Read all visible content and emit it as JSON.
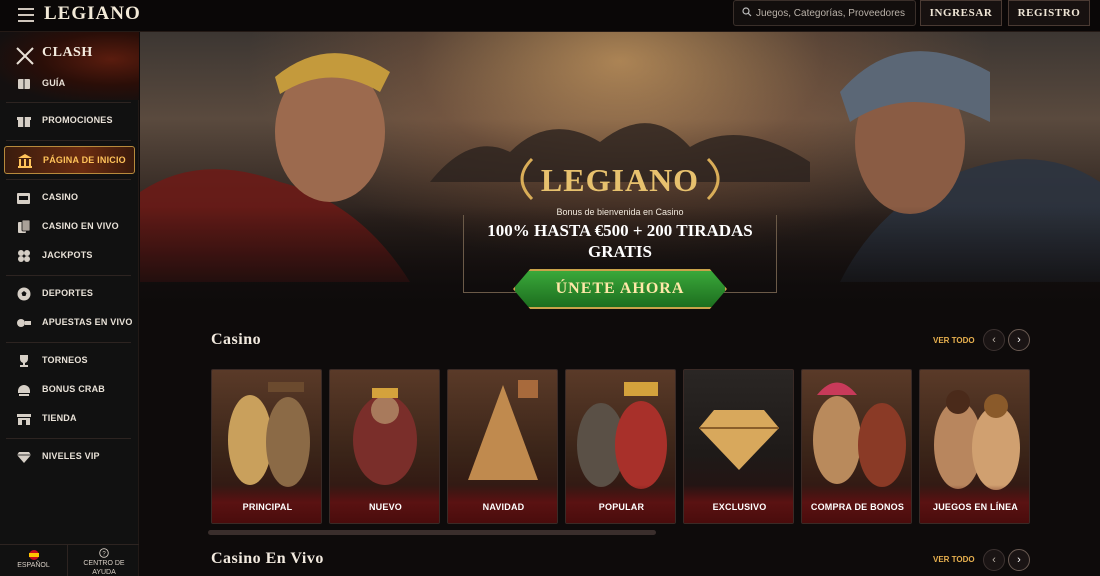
{
  "header": {
    "logo": "LEGIANO",
    "search_placeholder": "Juegos, Categorías, Proveedores",
    "login_label": "INGRESAR",
    "register_label": "REGISTRO"
  },
  "sidebar": {
    "clash_label": "CLASH",
    "items": [
      {
        "label": "GUÍA",
        "icon": "book-icon"
      },
      {
        "label": "PROMOCIONES",
        "icon": "gift-icon"
      },
      {
        "label": "PÁGINA DE INICIO",
        "icon": "temple-icon",
        "active": true
      },
      {
        "label": "CASINO",
        "icon": "slot-machine-icon"
      },
      {
        "label": "CASINO EN VIVO",
        "icon": "cards-icon"
      },
      {
        "label": "JACKPOTS",
        "icon": "clover-icon"
      },
      {
        "label": "DEPORTES",
        "icon": "ball-icon"
      },
      {
        "label": "APUESTAS EN VIVO",
        "icon": "live-bet-icon"
      },
      {
        "label": "TORNEOS",
        "icon": "trophy-icon"
      },
      {
        "label": "BONUS CRAB",
        "icon": "claw-icon"
      },
      {
        "label": "TIENDA",
        "icon": "shop-icon"
      },
      {
        "label": "NIVELES VIP",
        "icon": "diamond-icon"
      }
    ],
    "footer": {
      "language_label": "ESPAÑOL",
      "help_label_line1": "CENTRO DE",
      "help_label_line2": "AYUDA"
    }
  },
  "hero": {
    "logo": "LEGIANO",
    "subtitle": "Bonus de bienvenida en Casino",
    "promo_line1": "100% HASTA €500 + 200 TIRADAS",
    "promo_line2": "GRATIS",
    "cta_label": "ÚNETE AHORA"
  },
  "casino_section": {
    "title": "Casino",
    "see_all": "VER TODO",
    "cards": [
      {
        "label": "PRINCIPAL"
      },
      {
        "label": "NUEVO"
      },
      {
        "label": "NAVIDAD"
      },
      {
        "label": "POPULAR"
      },
      {
        "label": "EXCLUSIVO"
      },
      {
        "label": "COMPRA DE BONOS"
      },
      {
        "label": "JUEGOS EN LÍNEA"
      }
    ]
  },
  "live_section": {
    "title": "Casino En Vivo",
    "see_all": "VER TODO"
  },
  "colors": {
    "accent_gold": "#e7b04f",
    "active_highlight": "#ffc35a",
    "cta_green": "#2c8f2c",
    "card_caption": "#5a1212"
  }
}
